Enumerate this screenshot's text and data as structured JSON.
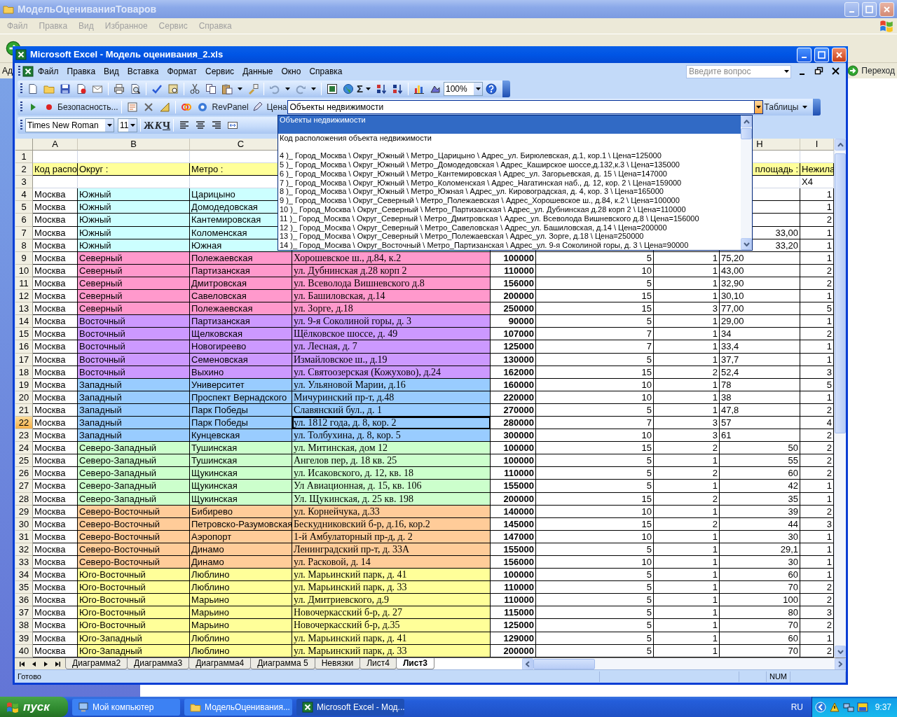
{
  "explorer": {
    "title": "МодельОцениванияТоваров",
    "menu": [
      "Файл",
      "Правка",
      "Вид",
      "Избранное",
      "Сервис",
      "Справка"
    ],
    "address_label": "Ад",
    "go_button": "Переход"
  },
  "excel": {
    "title": "Microsoft Excel - Модель оценивания_2.xls",
    "menu": [
      "Файл",
      "Правка",
      "Вид",
      "Вставка",
      "Формат",
      "Сервис",
      "Данные",
      "Окно",
      "Справка"
    ],
    "help_placeholder": "Введите вопрос",
    "sum_button": "Σ",
    "zoom": "100%",
    "security_button": "Безопасность...",
    "revpanel_button": "RevPanel",
    "price_button": "Цена",
    "combo_value": "Объекты недвижимости",
    "tables_button": "Таблицы",
    "font_box": "Times New Roman",
    "size_box": "11",
    "format_buttons": [
      {
        "label": "Ж",
        "kind": "bold"
      },
      {
        "label": "К",
        "kind": "italic"
      },
      {
        "label": "Ч",
        "kind": "underline"
      }
    ],
    "column_headers": {
      "A": "A",
      "B": "B",
      "C": "C",
      "H": "H",
      "I": "I"
    },
    "rows": [
      {
        "n": "1",
        "selected": false
      },
      {
        "n": "2",
        "kind": "header",
        "color": "#ffff99",
        "selected": false,
        "cells": {
          "A": "Код распо",
          "B": "Округ :",
          "C": "Метро :",
          "H": "площадь :",
          "I": "Нежила"
        }
      },
      {
        "n": "3",
        "selected": false,
        "cells": {
          "I": "X4"
        }
      },
      {
        "n": "4",
        "kind": "data",
        "color": "#ccffff",
        "selected": false,
        "cells": {
          "A": "Москва",
          "B": "Южный",
          "C": "Царицыно",
          "I": "1"
        }
      },
      {
        "n": "5",
        "kind": "data",
        "color": "#ccffff",
        "selected": false,
        "cells": {
          "A": "Москва",
          "B": "Южный",
          "C": "Домодедовская",
          "I": "1"
        }
      },
      {
        "n": "6",
        "kind": "data",
        "color": "#ccffff",
        "selected": false,
        "cells": {
          "A": "Москва",
          "B": "Южный",
          "C": "Кантемировская",
          "I": "2"
        }
      },
      {
        "n": "7",
        "kind": "data",
        "color": "#ccffff",
        "selected": false,
        "area_is_text": false,
        "cells": {
          "A": "Москва",
          "B": "Южный",
          "C": "Коломенская",
          "H": "33,00",
          "I": "1"
        }
      },
      {
        "n": "8",
        "kind": "data",
        "color": "#ccffff",
        "selected": false,
        "area_is_text": false,
        "cells": {
          "A": "Москва",
          "B": "Южный",
          "C": "Южная",
          "H": "33,20",
          "I": "1"
        }
      },
      {
        "n": "9",
        "kind": "data",
        "color": "#ff99cc",
        "selected": false,
        "area_is_text": true,
        "cells": {
          "A": "Москва",
          "B": "Северный",
          "C": "Полежаевская",
          "D": "Хорошевское ш., д.84, к.2",
          "E": "100000",
          "F": "5",
          "G": "1",
          "H": "75,20",
          "I": "1"
        }
      },
      {
        "n": "10",
        "kind": "data",
        "color": "#ff99cc",
        "selected": false,
        "area_is_text": true,
        "cells": {
          "A": "Москва",
          "B": "Северный",
          "C": "Партизанская",
          "D": "ул. Дубнинская д.28 корп 2",
          "E": "110000",
          "F": "10",
          "G": "1",
          "H": "43,00",
          "I": "2"
        }
      },
      {
        "n": "11",
        "kind": "data",
        "color": "#ff99cc",
        "selected": false,
        "area_is_text": true,
        "cells": {
          "A": "Москва",
          "B": "Северный",
          "C": "Дмитровская",
          "D": "ул. Всеволода Вишневского д.8",
          "E": "156000",
          "F": "5",
          "G": "1",
          "H": "32,90",
          "I": "2"
        }
      },
      {
        "n": "12",
        "kind": "data",
        "color": "#ff99cc",
        "selected": false,
        "area_is_text": true,
        "cells": {
          "A": "Москва",
          "B": "Северный",
          "C": "Савеловская",
          "D": "ул. Башиловская, д.14",
          "E": "200000",
          "F": "15",
          "G": "1",
          "H": "30,10",
          "I": "1"
        }
      },
      {
        "n": "13",
        "kind": "data",
        "color": "#ff99cc",
        "selected": false,
        "area_is_text": true,
        "cells": {
          "A": "Москва",
          "B": "Северный",
          "C": "Полежаевская",
          "D": "ул. Зорге, д.18",
          "E": "250000",
          "F": "15",
          "G": "3",
          "H": "77,00",
          "I": "5"
        }
      },
      {
        "n": "14",
        "kind": "data",
        "color": "#cc99ff",
        "selected": false,
        "area_is_text": true,
        "cells": {
          "A": "Москва",
          "B": "Восточный",
          "C": "Партизанская",
          "D": "ул. 9-я Соколиной горы, д. 3",
          "E": "90000",
          "F": "5",
          "G": "1",
          "H": "29,00",
          "I": "1"
        }
      },
      {
        "n": "15",
        "kind": "data",
        "color": "#cc99ff",
        "selected": false,
        "area_is_text": true,
        "cells": {
          "A": "Москва",
          "B": "Восточный",
          "C": "Щелковская",
          "D": "Щёлковское шоссе, д. 49",
          "E": "107000",
          "F": "7",
          "G": "1",
          "H": "34",
          "I": "2"
        }
      },
      {
        "n": "16",
        "kind": "data",
        "color": "#cc99ff",
        "selected": false,
        "area_is_text": true,
        "cells": {
          "A": "Москва",
          "B": "Восточный",
          "C": "Новогиреево",
          "D": "ул. Лесная, д. 7",
          "E": "125000",
          "F": "7",
          "G": "1",
          "H": "33,4",
          "I": "1"
        }
      },
      {
        "n": "17",
        "kind": "data",
        "color": "#cc99ff",
        "selected": false,
        "area_is_text": true,
        "cells": {
          "A": "Москва",
          "B": "Восточный",
          "C": "Семеновская",
          "D": "Измайловское ш., д.19",
          "E": "130000",
          "F": "5",
          "G": "1",
          "H": "37,7",
          "I": "1"
        }
      },
      {
        "n": "18",
        "kind": "data",
        "color": "#cc99ff",
        "selected": false,
        "area_is_text": true,
        "cells": {
          "A": "Москва",
          "B": "Восточный",
          "C": "Выхино",
          "D": "ул. Святоозерская (Кожухово), д.24",
          "E": "162000",
          "F": "15",
          "G": "2",
          "H": "52,4",
          "I": "3"
        }
      },
      {
        "n": "19",
        "kind": "data",
        "color": "#99ccff",
        "selected": false,
        "area_is_text": true,
        "cells": {
          "A": "Москва",
          "B": "Западный",
          "C": "Университет",
          "D": "ул. Ульяновой Марии, д.16",
          "E": "160000",
          "F": "10",
          "G": "1",
          "H": "78",
          "I": "5"
        }
      },
      {
        "n": "20",
        "kind": "data",
        "color": "#99ccff",
        "selected": false,
        "area_is_text": true,
        "cells": {
          "A": "Москва",
          "B": "Западный",
          "C": "Проспект Вернадского",
          "D": "Мичуринский пр-т, д.48",
          "E": "220000",
          "F": "10",
          "G": "1",
          "H": "38",
          "I": "1"
        }
      },
      {
        "n": "21",
        "kind": "data",
        "color": "#99ccff",
        "selected": false,
        "area_is_text": true,
        "cells": {
          "A": "Москва",
          "B": "Западный",
          "C": "Парк Победы",
          "D": "Славянский бул., д. 1",
          "E": "270000",
          "F": "5",
          "G": "1",
          "H": "47,8",
          "I": "2"
        }
      },
      {
        "n": "22",
        "kind": "data",
        "color": "#99ccff",
        "selected": true,
        "area_is_text": true,
        "cells": {
          "A": "Москва",
          "B": "Западный",
          "C": "Парк Победы",
          "D": "ул. 1812 года, д. 8, кор. 2",
          "E": "280000",
          "F": "7",
          "G": "3",
          "H": "57",
          "I": "4"
        }
      },
      {
        "n": "23",
        "kind": "data",
        "color": "#99ccff",
        "selected": false,
        "area_is_text": true,
        "cells": {
          "A": "Москва",
          "B": "Западный",
          "C": "Кунцевская",
          "D": "ул. Толбухина, д. 8, кор. 5",
          "E": "300000",
          "F": "10",
          "G": "3",
          "H": "61",
          "I": "2"
        }
      },
      {
        "n": "24",
        "kind": "data",
        "color": "#ccffcc",
        "selected": false,
        "area_is_text": false,
        "cells": {
          "A": "Москва",
          "B": "Северо-Западный",
          "C": "Тушинская",
          "D": "ул. Митинская, дом 12",
          "E": "100000",
          "F": "15",
          "G": "2",
          "H": "50",
          "I": "2"
        }
      },
      {
        "n": "25",
        "kind": "data",
        "color": "#ccffcc",
        "selected": false,
        "area_is_text": false,
        "cells": {
          "A": "Москва",
          "B": "Северо-Западный",
          "C": "Тушинская",
          "D": "Ангелов пер, д. 18 кв. 25",
          "E": "100000",
          "F": "5",
          "G": "1",
          "H": "55",
          "I": "2"
        }
      },
      {
        "n": "26",
        "kind": "data",
        "color": "#ccffcc",
        "selected": false,
        "area_is_text": false,
        "cells": {
          "A": "Москва",
          "B": "Северо-Западный",
          "C": "Щукинская",
          "D": "ул. Исаковского, д. 12, кв. 18",
          "E": "110000",
          "F": "5",
          "G": "2",
          "H": "60",
          "I": "2"
        }
      },
      {
        "n": "27",
        "kind": "data",
        "color": "#ccffcc",
        "selected": false,
        "area_is_text": false,
        "cells": {
          "A": "Москва",
          "B": "Северо-Западный",
          "C": "Щукинская",
          "D": "Ул Авиационная, д. 15, кв. 106",
          "E": "155000",
          "F": "5",
          "G": "1",
          "H": "42",
          "I": "1"
        }
      },
      {
        "n": "28",
        "kind": "data",
        "color": "#ccffcc",
        "selected": false,
        "area_is_text": false,
        "cells": {
          "A": "Москва",
          "B": "Северо-Западный",
          "C": "Щукинская",
          "D": "Ул. Щукинская, д. 25 кв. 198",
          "E": "200000",
          "F": "15",
          "G": "2",
          "H": "35",
          "I": "1"
        }
      },
      {
        "n": "29",
        "kind": "data",
        "color": "#ffcc99",
        "selected": false,
        "area_is_text": false,
        "cells": {
          "A": "Москва",
          "B": "Северо-Восточный",
          "C": "Бибирево",
          "D": "ул. Корнейчука, д.33",
          "E": "140000",
          "F": "10",
          "G": "1",
          "H": "39",
          "I": "2"
        }
      },
      {
        "n": "30",
        "kind": "data",
        "color": "#ffcc99",
        "selected": false,
        "area_is_text": false,
        "cells": {
          "A": "Москва",
          "B": "Северо-Восточный",
          "C": "Петровско-Разумовская",
          "D": "Бескудниковский б-р, д.16, кор.2",
          "E": "145000",
          "F": "15",
          "G": "2",
          "H": "44",
          "I": "3"
        }
      },
      {
        "n": "31",
        "kind": "data",
        "color": "#ffcc99",
        "selected": false,
        "area_is_text": false,
        "cells": {
          "A": "Москва",
          "B": "Северо-Восточный",
          "C": "Аэропорт",
          "D": "1-й Амбулаторный пр-д, д. 2",
          "E": "147000",
          "F": "10",
          "G": "1",
          "H": "30",
          "I": "1"
        }
      },
      {
        "n": "32",
        "kind": "data",
        "color": "#ffcc99",
        "selected": false,
        "area_is_text": false,
        "cells": {
          "A": "Москва",
          "B": "Северо-Восточный",
          "C": "Динамо",
          "D": "Ленинградский пр-т, д. 33А",
          "E": "155000",
          "F": "5",
          "G": "1",
          "H": "29,1",
          "I": "1"
        }
      },
      {
        "n": "33",
        "kind": "data",
        "color": "#ffcc99",
        "selected": false,
        "area_is_text": false,
        "cells": {
          "A": "Москва",
          "B": "Северо-Восточный",
          "C": "Динамо",
          "D": "ул. Расковой, д. 14",
          "E": "156000",
          "F": "10",
          "G": "1",
          "H": "30",
          "I": "1"
        }
      },
      {
        "n": "34",
        "kind": "data",
        "color": "#ffff99",
        "selected": false,
        "area_is_text": false,
        "cells": {
          "A": "Москва",
          "B": "Юго-Восточный",
          "C": "Люблино",
          "D": "ул. Марьинский парк, д. 41",
          "E": "100000",
          "F": "5",
          "G": "1",
          "H": "60",
          "I": "1"
        }
      },
      {
        "n": "35",
        "kind": "data",
        "color": "#ffff99",
        "selected": false,
        "area_is_text": false,
        "cells": {
          "A": "Москва",
          "B": "Юго-Восточный",
          "C": "Люблино",
          "D": "ул. Марьинский парк, д. 33",
          "E": "110000",
          "F": "5",
          "G": "1",
          "H": "70",
          "I": "2"
        }
      },
      {
        "n": "36",
        "kind": "data",
        "color": "#ffff99",
        "selected": false,
        "area_is_text": false,
        "cells": {
          "A": "Москва",
          "B": "Юго-Восточный",
          "C": "Марьино",
          "D": "ул. Дмитриевского, д.9",
          "E": "110000",
          "F": "5",
          "G": "1",
          "H": "100",
          "I": "2"
        }
      },
      {
        "n": "37",
        "kind": "data",
        "color": "#ffff99",
        "selected": false,
        "area_is_text": false,
        "cells": {
          "A": "Москва",
          "B": "Юго-Восточный",
          "C": "Марьино",
          "D": "Новочеркасский б-р, д. 27",
          "E": "115000",
          "F": "5",
          "G": "1",
          "H": "80",
          "I": "3"
        }
      },
      {
        "n": "38",
        "kind": "data",
        "color": "#ffff99",
        "selected": false,
        "area_is_text": false,
        "cells": {
          "A": "Москва",
          "B": "Юго-Восточный",
          "C": "Марьино",
          "D": "Новочеркасский б-р, д.35",
          "E": "125000",
          "F": "5",
          "G": "1",
          "H": "70",
          "I": "2"
        }
      },
      {
        "n": "39",
        "kind": "data",
        "color": "#ffff99",
        "selected": false,
        "area_is_text": false,
        "cells": {
          "A": "Москва",
          "B": "Юго-Западный",
          "C": "Люблино",
          "D": "ул. Марьинский парк, д. 41",
          "E": "129000",
          "F": "5",
          "G": "1",
          "H": "60",
          "I": "1"
        }
      },
      {
        "n": "40",
        "kind": "data",
        "color": "#ffff99",
        "selected": false,
        "area_is_text": false,
        "cells": {
          "A": "Москва",
          "B": "Юго-Западный",
          "C": "Люблино",
          "D": "ул. Марьинский парк, д. 33",
          "E": "200000",
          "F": "5",
          "G": "1",
          "H": "70",
          "I": "2"
        }
      }
    ],
    "dropdown": [
      {
        "text": "Объекты недвижимости",
        "selected": true,
        "gap_after": true
      },
      {
        "text": "Код расположения объекта недвижимости",
        "selected": false,
        "gap_after": true
      },
      {
        "text": "4 )_ Город_Москва \\ Округ_Южный \\ Метро_Царицыно \\ Адрес_ул. Бирюлевская, д.1, кор.1 \\ Цена=125000",
        "selected": false,
        "gap_after": false
      },
      {
        "text": "5 )_ Город_Москва \\ Округ_Южный \\ Метро_Домодедовская \\ Адрес_Каширское шоссе,д.132,к.3 \\ Цена=135000",
        "selected": false,
        "gap_after": false
      },
      {
        "text": "6 )_ Город_Москва \\ Округ_Южный \\ Метро_Кантемировская \\ Адрес_ул. Загорьевская, д. 15 \\ Цена=147000",
        "selected": false,
        "gap_after": false
      },
      {
        "text": "7 )_ Город_Москва \\ Округ_Южный \\ Метро_Коломенская \\ Адрес_Нагатинская наб., д. 12, кор. 2 \\ Цена=159000",
        "selected": false,
        "gap_after": false
      },
      {
        "text": "8 )_ Город_Москва \\ Округ_Южный \\ Метро_Южная \\ Адрес_ул. Кировоградская, д. 4, кор. 3 \\ Цена=165000",
        "selected": false,
        "gap_after": false
      },
      {
        "text": "9 )_ Город_Москва \\ Округ_Северный \\ Метро_Полежаевская \\ Адрес_Хорошевское ш., д.84, к.2 \\ Цена=100000",
        "selected": false,
        "gap_after": false
      },
      {
        "text": "10 )_ Город_Москва \\ Округ_Северный \\ Метро_Партизанская \\ Адрес_ул. Дубнинская д.28 корп 2 \\ Цена=110000",
        "selected": false,
        "gap_after": false
      },
      {
        "text": "11 )_ Город_Москва \\ Округ_Северный \\ Метро_Дмитровская \\ Адрес_ул. Всеволода Вишневского д.8 \\ Цена=156000",
        "selected": false,
        "gap_after": false
      },
      {
        "text": "12 )_ Город_Москва \\ Округ_Северный \\ Метро_Савеловская \\ Адрес_ул. Башиловская, д.14 \\ Цена=200000",
        "selected": false,
        "gap_after": false
      },
      {
        "text": "13 )_ Город_Москва \\ Округ_Северный \\ Метро_Полежаевская \\ Адрес_ул. Зорге, д.18 \\ Цена=250000",
        "selected": false,
        "gap_after": false
      },
      {
        "text": "14 )_ Город_Москва \\ Округ_Восточный \\ Метро_Партизанская \\ Адрес_ул. 9-я Соколиной горы, д. 3 \\ Цена=90000",
        "selected": false,
        "gap_after": false
      }
    ],
    "sheet_tabs": [
      {
        "label": "Диаграмма2",
        "selected": false
      },
      {
        "label": "Диаграмма3",
        "selected": false
      },
      {
        "label": "Диаграмма4",
        "selected": false
      },
      {
        "label": "Диаграмма 5",
        "selected": false
      },
      {
        "label": "Невязки",
        "selected": false
      },
      {
        "label": "Лист4",
        "selected": false
      },
      {
        "label": "Лист3",
        "selected": true
      }
    ],
    "status_text": "Готово",
    "status_num": "NUM"
  },
  "taskbar": {
    "start": "пуск",
    "tasks": [
      {
        "label": "Мой компьютер",
        "kind": "computer",
        "selected": false
      },
      {
        "label": "МодельОценивания...",
        "kind": "folder",
        "selected": false
      },
      {
        "label": "Microsoft Excel - Мод...",
        "kind": "excel",
        "selected": true
      }
    ],
    "language": "RU",
    "clock": "9:37"
  }
}
